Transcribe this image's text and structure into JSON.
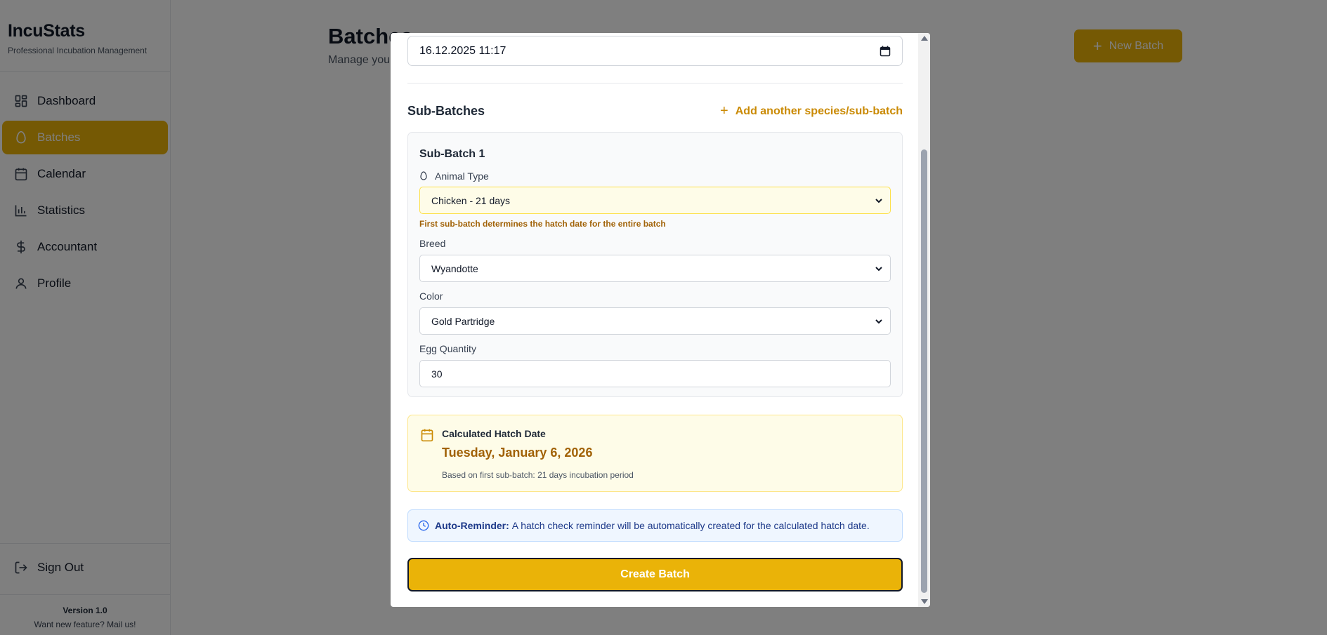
{
  "app": {
    "title": "IncuStats",
    "subtitle": "Professional Incubation Management"
  },
  "sidebar": {
    "items": [
      {
        "label": "Dashboard",
        "icon": "dashboard-icon"
      },
      {
        "label": "Batches",
        "icon": "egg-icon",
        "active": true
      },
      {
        "label": "Calendar",
        "icon": "calendar-icon"
      },
      {
        "label": "Statistics",
        "icon": "bar-chart-icon"
      },
      {
        "label": "Accountant",
        "icon": "dollar-icon"
      },
      {
        "label": "Profile",
        "icon": "user-icon"
      }
    ],
    "sign_out": "Sign Out",
    "version": "Version 1.0",
    "feature_note": "Want new feature? Mail us!"
  },
  "main": {
    "title": "Batches",
    "subtitle": "Manage your",
    "new_batch_label": "New Batch"
  },
  "modal": {
    "start_date_value": "16.12.2025  11:17",
    "sub_batches_label": "Sub-Batches",
    "add_sub_batch_label": "Add another species/sub-batch",
    "sub_batch": {
      "title": "Sub-Batch 1",
      "animal_type_label": "Animal Type",
      "animal_type_value": "Chicken - 21 days",
      "hint": "First sub-batch determines the hatch date for the entire batch",
      "breed_label": "Breed",
      "breed_value": "Wyandotte",
      "color_label": "Color",
      "color_value": "Gold Partridge",
      "egg_quantity_label": "Egg Quantity",
      "egg_quantity_value": "30"
    },
    "hatch": {
      "label": "Calculated Hatch Date",
      "date": "Tuesday, January 6, 2026",
      "note": "Based on first sub-batch: 21 days incubation period"
    },
    "reminder": {
      "bold": "Auto-Reminder:",
      "text": "A hatch check reminder will be automatically created for the calculated hatch date."
    },
    "create_label": "Create Batch"
  },
  "colors": {
    "accent": "#eab308",
    "accent_dark": "#a16207",
    "info_bg": "#eff6ff"
  }
}
